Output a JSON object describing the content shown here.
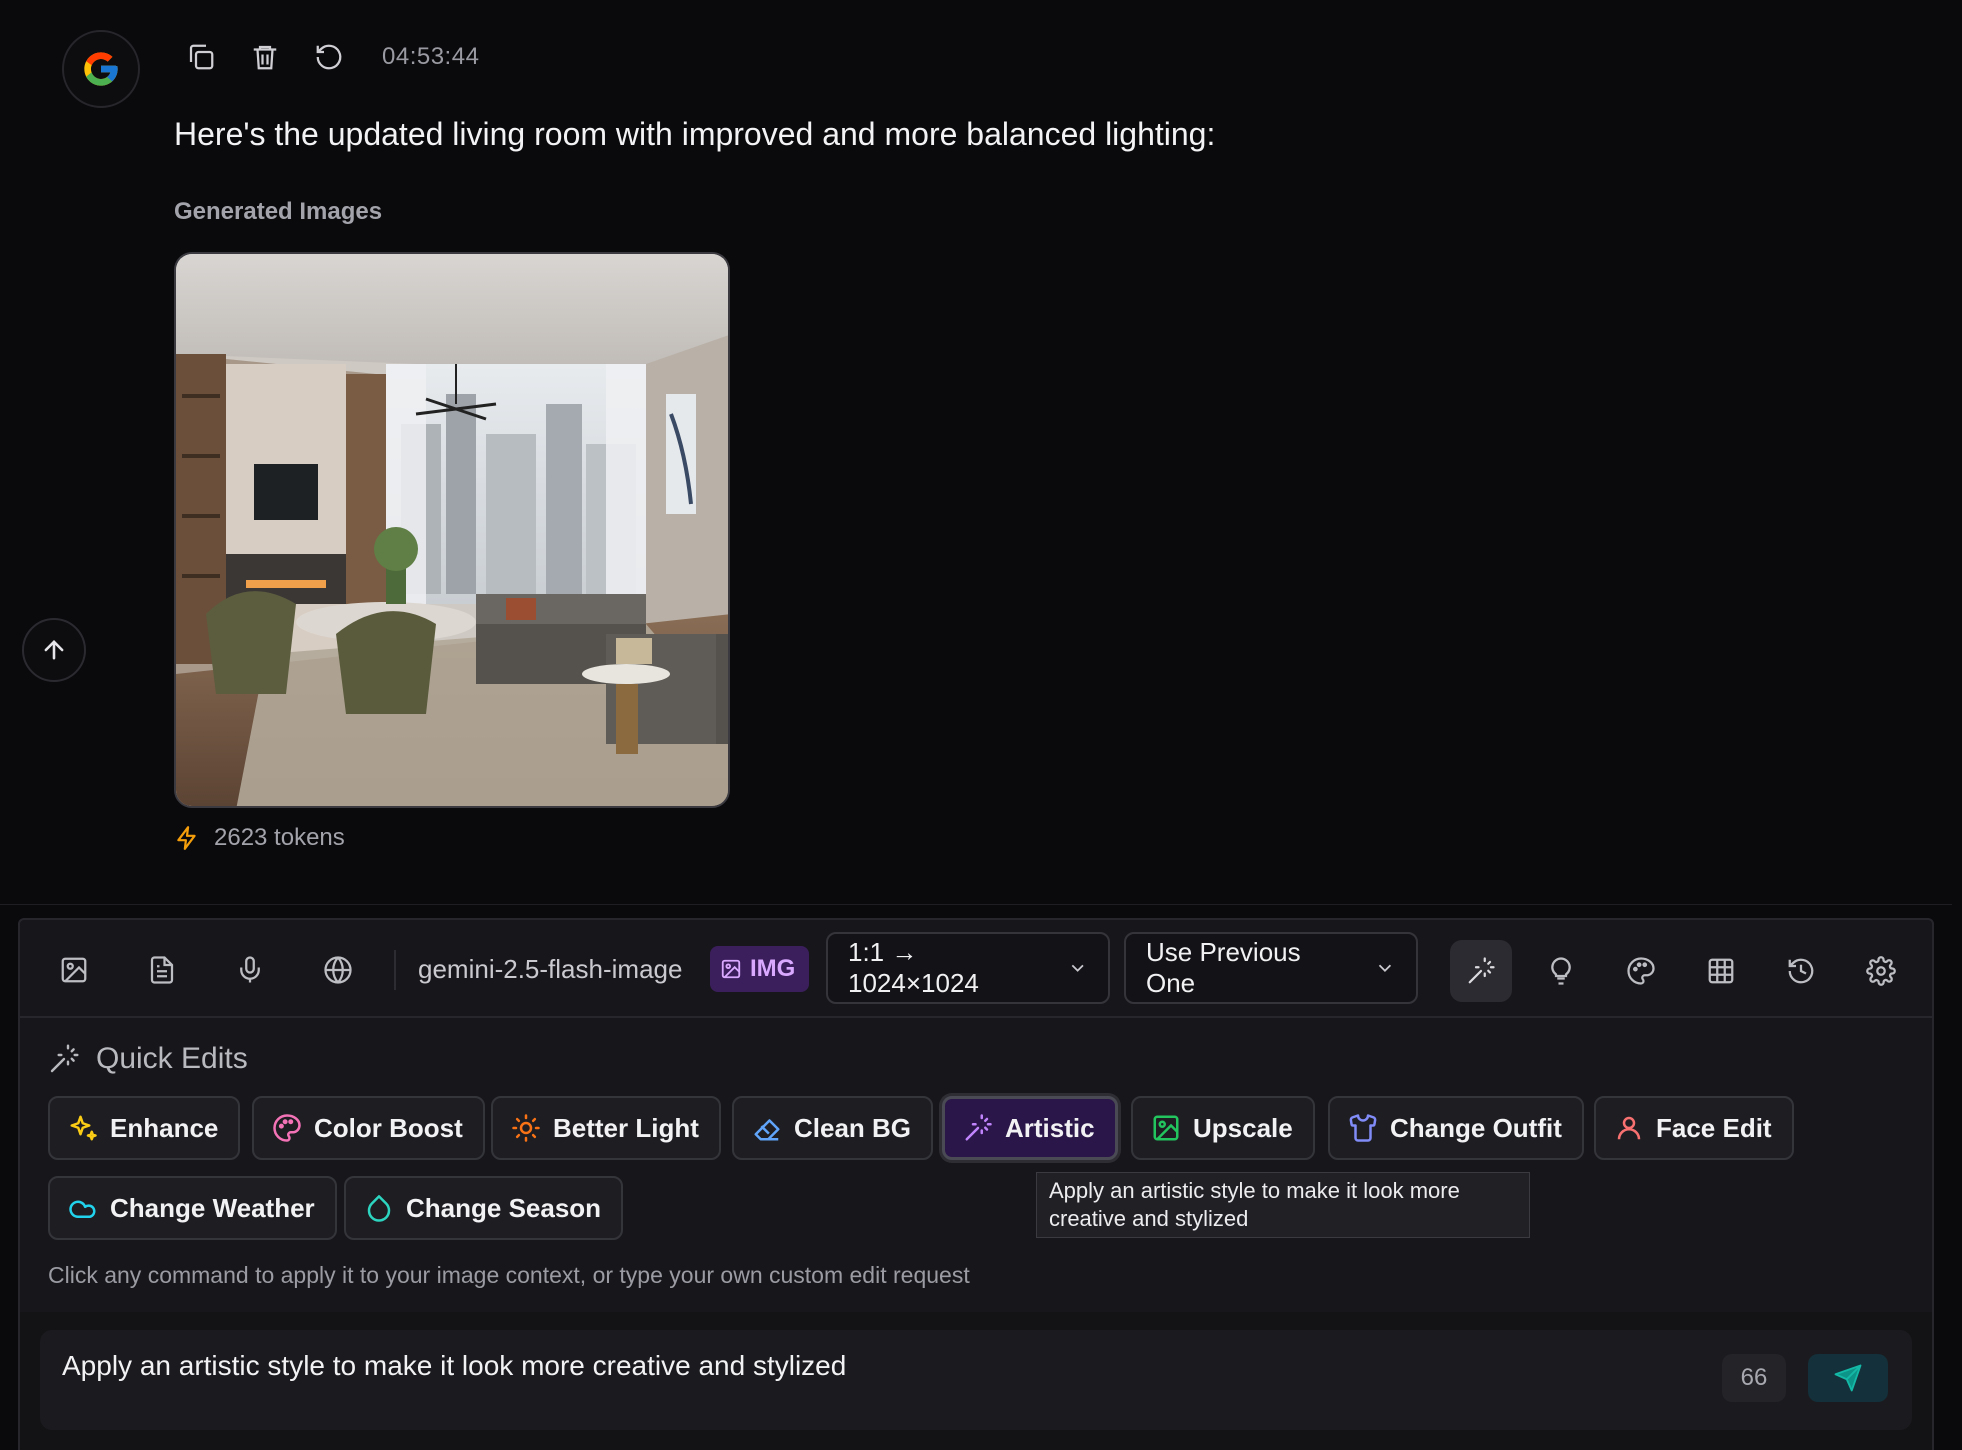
{
  "message": {
    "avatar_letter": "G",
    "timestamp": "04:53:44",
    "text": "Here's the updated living room with improved and more balanced lighting:",
    "generated_label": "Generated Images",
    "tokens_label": "2623 tokens"
  },
  "toolbar": {
    "model_name": "gemini-2.5-flash-image",
    "img_badge": "IMG",
    "aspect_select": "1:1 → 1024×1024",
    "context_select": "Use Previous One"
  },
  "quick_edits": {
    "title": "Quick Edits",
    "chips": [
      {
        "label": "Enhance"
      },
      {
        "label": "Color Boost"
      },
      {
        "label": "Better Light"
      },
      {
        "label": "Clean BG"
      },
      {
        "label": "Artistic"
      },
      {
        "label": "Upscale"
      },
      {
        "label": "Change Outfit"
      },
      {
        "label": "Face Edit"
      },
      {
        "label": "Change Weather"
      },
      {
        "label": "Change Season"
      }
    ],
    "tooltip": "Apply an artistic style to make it look more creative and stylized",
    "hint": "Click any command to apply it to your image context, or type your own custom edit request"
  },
  "input": {
    "value": "Apply an artistic style to make it look more creative and stylized",
    "char_count": "66"
  },
  "colors": {
    "background": "#0a0a0d",
    "panel": "#17171b",
    "accent_purple": "#c084fc",
    "accent_teal": "#2dd4bf",
    "token_orange": "#f59e0b"
  }
}
